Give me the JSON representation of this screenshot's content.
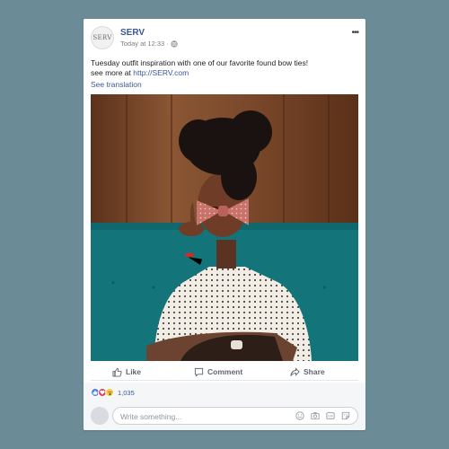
{
  "post": {
    "page_name": "SERV",
    "avatar_text": "SERV",
    "timestamp": "Today at 12:33 ·",
    "text_line1": "Tuesday outfit inspiration with one of our favorite found bow ties!",
    "text_line2_prefix": "see more at ",
    "text_link": "http://SERV.com",
    "see_translation": "See translation"
  },
  "photo": {
    "description_icon": "photo-of-woman-in-polka-dot-shirt-and-bow-tie"
  },
  "actions": {
    "like_label": "Like",
    "comment_label": "Comment",
    "share_label": "Share"
  },
  "reactions": {
    "icons": [
      "like-reaction-icon",
      "love-reaction-icon",
      "wow-reaction-icon"
    ],
    "count": "1,035"
  },
  "composer": {
    "placeholder": "Write something..."
  },
  "colors": {
    "background": "#6b8c96",
    "link_blue": "#385898",
    "like_blue": "#4a7bea",
    "love_red": "#ea3e56",
    "wow_yellow": "#f7c945"
  }
}
